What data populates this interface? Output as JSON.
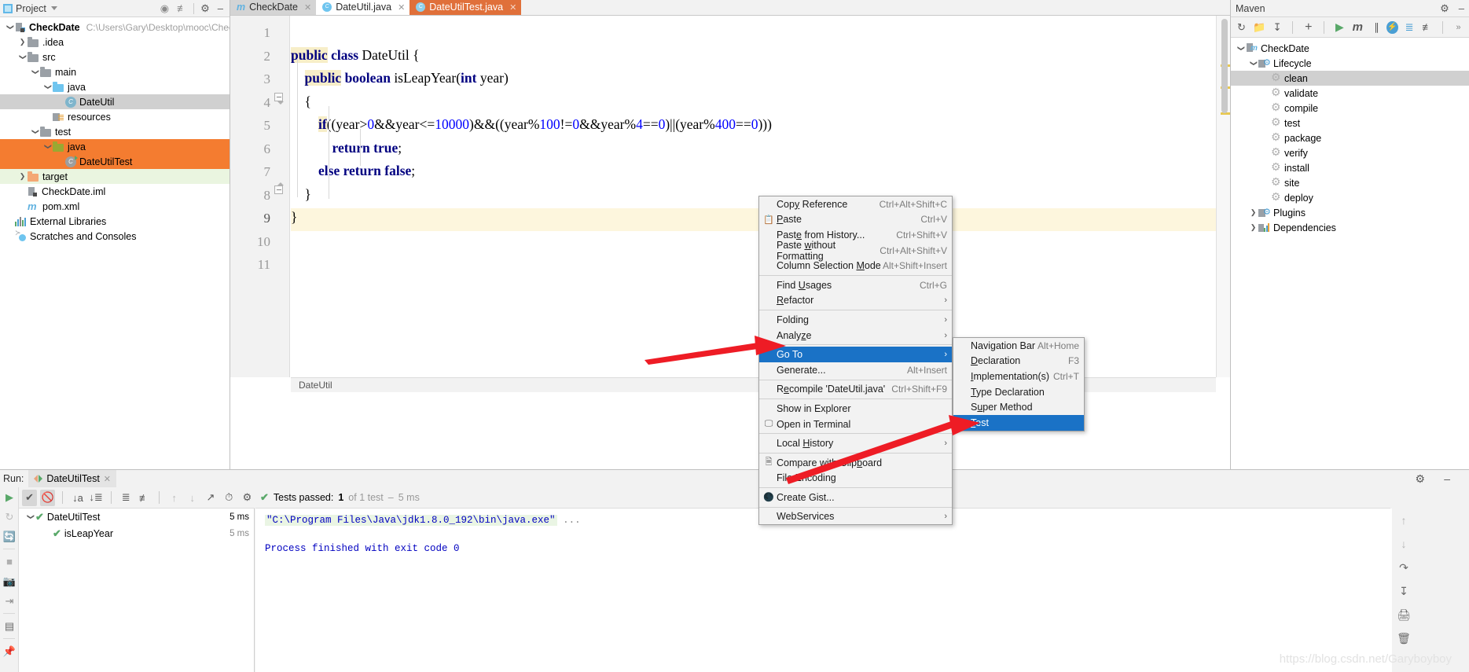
{
  "project_panel": {
    "title": "Project",
    "tree": [
      {
        "indent": 0,
        "arrow": "down",
        "icon": "module-icon",
        "label": "CheckDate",
        "bold": true,
        "path": "C:\\Users\\Gary\\Desktop\\mooc\\CheckDate",
        "state": "none"
      },
      {
        "indent": 1,
        "arrow": "right",
        "icon": "folder-icon",
        "label": ".idea",
        "state": "none"
      },
      {
        "indent": 1,
        "arrow": "down",
        "icon": "folder-icon",
        "label": "src",
        "state": "none"
      },
      {
        "indent": 2,
        "arrow": "down",
        "icon": "folder-icon",
        "label": "main",
        "state": "none"
      },
      {
        "indent": 3,
        "arrow": "down",
        "icon": "folder-blue-icon",
        "label": "java",
        "state": "none"
      },
      {
        "indent": 4,
        "arrow": "none",
        "icon": "java-class-icon",
        "label": "DateUtil",
        "state": "selected-grey"
      },
      {
        "indent": 3,
        "arrow": "none",
        "icon": "resources-icon",
        "label": "resources",
        "state": "none"
      },
      {
        "indent": 2,
        "arrow": "down",
        "icon": "folder-icon",
        "label": "test",
        "state": "none"
      },
      {
        "indent": 3,
        "arrow": "down",
        "icon": "folder-olive-icon",
        "label": "java",
        "state": "selected-orange"
      },
      {
        "indent": 4,
        "arrow": "none",
        "icon": "java-test-class-icon",
        "label": "DateUtilTest",
        "state": "selected-orange"
      },
      {
        "indent": 1,
        "arrow": "right",
        "icon": "folder-orange-icon",
        "label": "target",
        "state": "selected-green"
      },
      {
        "indent": 1,
        "arrow": "none",
        "icon": "iml-file-icon",
        "label": "CheckDate.iml",
        "state": "none"
      },
      {
        "indent": 1,
        "arrow": "none",
        "icon": "maven-pom-icon",
        "label": "pom.xml",
        "state": "none"
      },
      {
        "indent": 0,
        "arrow": "none",
        "icon": "libraries-icon",
        "label": "External Libraries",
        "state": "none"
      },
      {
        "indent": 0,
        "arrow": "none",
        "icon": "scratches-icon",
        "label": "Scratches and Consoles",
        "state": "none"
      }
    ]
  },
  "editor": {
    "tabs": [
      {
        "label": "CheckDate",
        "icon": "maven-icon",
        "state": "inactive-grey",
        "closable": true
      },
      {
        "label": "DateUtil.java",
        "icon": "java-class-icon",
        "state": "active-white",
        "closable": true
      },
      {
        "label": "DateUtilTest.java",
        "icon": "java-class-icon",
        "state": "active-orange",
        "closable": true
      }
    ],
    "line_numbers": [
      "1",
      "2",
      "3",
      "4",
      "5",
      "6",
      "7",
      "8",
      "9",
      "10",
      "11"
    ],
    "code_lines": [
      "",
      "public class DateUtil {",
      "    public boolean isLeapYear(int year)",
      "    {",
      "        if((year>0&&year<=10000)&&((year%100!=0&&year%4==0)||(year%400==0)))",
      "            return true;",
      "        else return false;",
      "    }",
      "}",
      "",
      ""
    ],
    "breadcrumb": "DateUtil",
    "caret_line": 9
  },
  "maven_panel": {
    "title": "Maven",
    "toolbar_icons": [
      "refresh-icon",
      "add-module-icon",
      "download-sources-icon",
      "plus-icon",
      "run-icon",
      "maven-goal-icon",
      "toggle-skip-tests-icon",
      "execute-icon",
      "expand-all-icon",
      "collapse-all-icon",
      "more-icon"
    ],
    "tree": [
      {
        "indent": 0,
        "arrow": "down",
        "icon": "maven-project-icon",
        "label": "CheckDate",
        "state": "none"
      },
      {
        "indent": 1,
        "arrow": "down",
        "icon": "lifecycle-icon",
        "label": "Lifecycle",
        "state": "none"
      },
      {
        "indent": 2,
        "arrow": "none",
        "icon": "goal-icon",
        "label": "clean",
        "state": "selected-grey"
      },
      {
        "indent": 2,
        "arrow": "none",
        "icon": "goal-icon",
        "label": "validate",
        "state": "none"
      },
      {
        "indent": 2,
        "arrow": "none",
        "icon": "goal-icon",
        "label": "compile",
        "state": "none"
      },
      {
        "indent": 2,
        "arrow": "none",
        "icon": "goal-icon",
        "label": "test",
        "state": "none"
      },
      {
        "indent": 2,
        "arrow": "none",
        "icon": "goal-icon",
        "label": "package",
        "state": "none"
      },
      {
        "indent": 2,
        "arrow": "none",
        "icon": "goal-icon",
        "label": "verify",
        "state": "none"
      },
      {
        "indent": 2,
        "arrow": "none",
        "icon": "goal-icon",
        "label": "install",
        "state": "none"
      },
      {
        "indent": 2,
        "arrow": "none",
        "icon": "goal-icon",
        "label": "site",
        "state": "none"
      },
      {
        "indent": 2,
        "arrow": "none",
        "icon": "goal-icon",
        "label": "deploy",
        "state": "none"
      },
      {
        "indent": 1,
        "arrow": "right",
        "icon": "plugins-icon",
        "label": "Plugins",
        "state": "none"
      },
      {
        "indent": 1,
        "arrow": "right",
        "icon": "dependencies-icon",
        "label": "Dependencies",
        "state": "none"
      }
    ]
  },
  "context_menu": {
    "items": [
      {
        "label": "Copy Reference",
        "key": "Ctrl+Alt+Shift+C",
        "icon": "",
        "mnemonic": "y"
      },
      {
        "label": "Paste",
        "key": "Ctrl+V",
        "icon": "clipboard-icon",
        "mnemonic": "P"
      },
      {
        "label": "Paste from History...",
        "key": "Ctrl+Shift+V",
        "icon": "",
        "mnemonic": "e"
      },
      {
        "label": "Paste without Formatting",
        "key": "Ctrl+Alt+Shift+V",
        "icon": "",
        "mnemonic": "w"
      },
      {
        "label": "Column Selection Mode",
        "key": "Alt+Shift+Insert",
        "icon": "",
        "mnemonic": "M"
      },
      {
        "separator": true
      },
      {
        "label": "Find Usages",
        "key": "Ctrl+G",
        "icon": "",
        "mnemonic": "U"
      },
      {
        "label": "Refactor",
        "key": "",
        "arrow": true,
        "icon": "",
        "mnemonic": "R"
      },
      {
        "separator": true
      },
      {
        "label": "Folding",
        "key": "",
        "arrow": true,
        "icon": ""
      },
      {
        "label": "Analyze",
        "key": "",
        "arrow": true,
        "icon": "",
        "mnemonic": "z"
      },
      {
        "separator": true
      },
      {
        "label": "Go To",
        "key": "",
        "arrow": true,
        "icon": "",
        "selected": true
      },
      {
        "label": "Generate...",
        "key": "Alt+Insert",
        "icon": ""
      },
      {
        "separator": true
      },
      {
        "label": "Recompile 'DateUtil.java'",
        "key": "Ctrl+Shift+F9",
        "icon": "",
        "mnemonic": "e"
      },
      {
        "separator": true
      },
      {
        "label": "Show in Explorer",
        "key": "",
        "icon": ""
      },
      {
        "label": "Open in Terminal",
        "key": "",
        "icon": "terminal-icon"
      },
      {
        "separator": true
      },
      {
        "label": "Local History",
        "key": "",
        "arrow": true,
        "icon": "",
        "mnemonic": "H"
      },
      {
        "separator": true
      },
      {
        "label": "Compare with Clipboard",
        "key": "",
        "icon": "compare-icon",
        "mnemonic": "b"
      },
      {
        "label": "File Encoding",
        "key": "",
        "icon": ""
      },
      {
        "separator": true
      },
      {
        "label": "Create Gist...",
        "key": "",
        "icon": "github-icon"
      },
      {
        "separator": true
      },
      {
        "label": "WebServices",
        "key": "",
        "arrow": true,
        "icon": ""
      }
    ]
  },
  "context_submenu": {
    "items": [
      {
        "label": "Navigation Bar",
        "key": "Alt+Home"
      },
      {
        "label": "Declaration",
        "key": "F3"
      },
      {
        "label": "Implementation(s)",
        "key": "Ctrl+T"
      },
      {
        "label": "Type Declaration",
        "key": ""
      },
      {
        "label": "Super Method",
        "key": ""
      },
      {
        "label": "Test",
        "key": "",
        "selected": true
      }
    ]
  },
  "run_panel": {
    "run_label": "Run:",
    "tab_label": "DateUtilTest",
    "toolbar_icons": [
      "rerun-icon",
      "rerun-failed-icon",
      "toggle-auto-test-icon",
      "sort-alpha-icon",
      "sort-duration-icon",
      "expand-all-icon",
      "collapse-all-icon",
      "prev-failed-icon",
      "next-failed-icon",
      "export-icon",
      "history-icon",
      "settings-icon"
    ],
    "left_rail_icons": [
      "run-icon",
      "rerun-icon",
      "restart-icon",
      "stop-icon",
      "dump-threads-icon",
      "print-icon",
      "layout-icon",
      "pin-icon"
    ],
    "tests": [
      {
        "label": "DateUtilTest",
        "duration": "5 ms",
        "status": "passed",
        "indent": 0,
        "expanded": true
      },
      {
        "label": "isLeapYear",
        "duration": "5 ms",
        "status": "passed",
        "indent": 1
      }
    ],
    "status": {
      "prefix": "Tests passed:",
      "count": "1",
      "suffix": "of 1 test",
      "separator": "–",
      "duration": "5 ms"
    },
    "console_lines": [
      {
        "text": "\"C:\\Program Files\\Java\\jdk1.8.0_192\\bin\\java.exe\"",
        "highlight": true,
        "trailing": "..."
      },
      {
        "text": "",
        "highlight": false
      },
      {
        "text": "Process finished with exit code 0",
        "highlight": false
      }
    ],
    "right_rail_icons": [
      "up-icon",
      "down-icon",
      "soft-wrap-icon",
      "scroll-to-end-icon",
      "print-icon",
      "trash-icon"
    ]
  },
  "watermark": "https://blog.csdn.net/Garyboyboy",
  "colors": {
    "selection_orange": "#f47c30",
    "selection_blue": "#1a72c6",
    "tab_active_orange": "#e0703a",
    "keyword_blue": "#000080",
    "number_blue": "#0000ff",
    "pass_green": "#59a869",
    "arrow_red": "#ee1c25"
  }
}
